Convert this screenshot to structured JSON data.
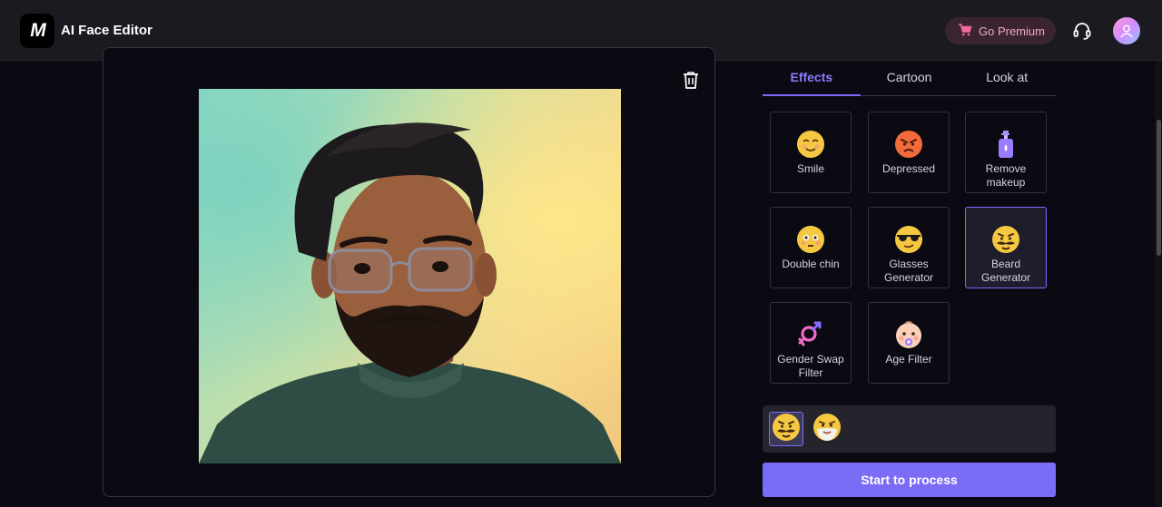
{
  "header": {
    "logo_text": "M",
    "app_title": "AI Face Editor",
    "premium_label": "Go Premium",
    "icons": {
      "cart": "cart-icon",
      "support": "headset-icon",
      "avatar": "user-avatar-icon"
    }
  },
  "tabs": [
    {
      "label": "Effects",
      "active": true
    },
    {
      "label": "Cartoon",
      "active": false
    },
    {
      "label": "Look at",
      "active": false
    }
  ],
  "effects": [
    {
      "label": "Smile",
      "icon": "smile-emoji-icon"
    },
    {
      "label": "Depressed",
      "icon": "angry-emoji-icon"
    },
    {
      "label": "Remove makeup",
      "icon": "lotion-bottle-icon"
    },
    {
      "label": "Double chin",
      "icon": "flushed-emoji-icon"
    },
    {
      "label": "Glasses Generator",
      "icon": "sunglasses-emoji-icon"
    },
    {
      "label": "Beard Generator",
      "icon": "beard-emoji-icon",
      "selected": true
    },
    {
      "label": "Gender Swap Filter",
      "icon": "gender-symbol-icon"
    },
    {
      "label": "Age Filter",
      "icon": "baby-emoji-icon"
    }
  ],
  "tray": [
    {
      "icon": "beard-emoji-icon",
      "selected": true
    },
    {
      "icon": "white-beard-emoji-icon",
      "selected": false
    }
  ],
  "start_button": "Start to process",
  "colors": {
    "accent": "#7b6cf6",
    "header_bg": "#1b1a21",
    "page_bg": "#0b0a12"
  }
}
